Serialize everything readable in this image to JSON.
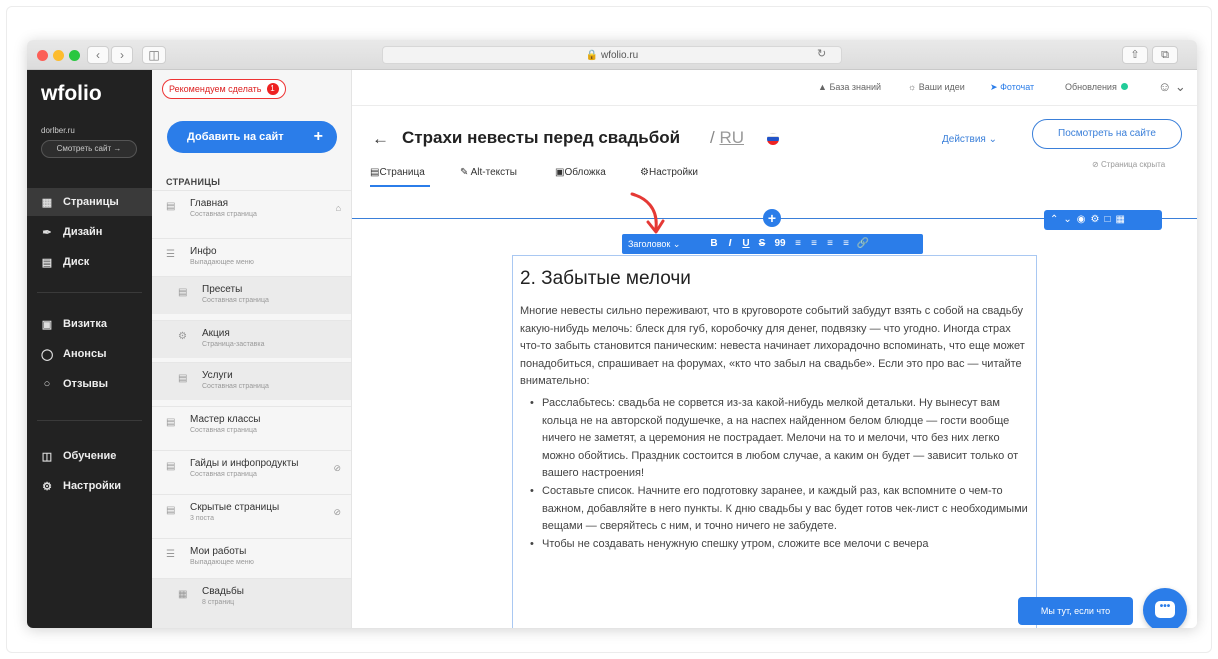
{
  "browser": {
    "url": "wfolio.ru"
  },
  "sidebar": {
    "logo": "wfolio",
    "site": "dorlber.ru",
    "view_site": "Смотреть сайт →",
    "items": [
      {
        "label": "Страницы",
        "icon": "page-icon"
      },
      {
        "label": "Дизайн",
        "icon": "brush-icon"
      },
      {
        "label": "Диск",
        "icon": "disk-icon"
      },
      {
        "label": "Визитка",
        "icon": "card-icon"
      },
      {
        "label": "Анонсы",
        "icon": "megaphone-icon"
      },
      {
        "label": "Отзывы",
        "icon": "chat-icon"
      },
      {
        "label": "Обучение",
        "icon": "book-icon"
      },
      {
        "label": "Настройки",
        "icon": "gear-icon"
      }
    ]
  },
  "pages_panel": {
    "recommend": "Рекомендуем сделать",
    "recommend_count": "1",
    "add_button": "Добавить на сайт",
    "heading": "СТРАНИЦЫ",
    "pages": [
      {
        "title": "Главная",
        "sub": "Составная страница"
      },
      {
        "title": "Инфо",
        "sub": "Выпадающее меню"
      },
      {
        "title": "Пресеты",
        "sub": "Составная страница"
      },
      {
        "title": "Акция",
        "sub": "Страница-заставка"
      },
      {
        "title": "Услуги",
        "sub": "Составная страница"
      },
      {
        "title": "Мастер классы",
        "sub": "Составная страница"
      },
      {
        "title": "Гайды и инфопродукты",
        "sub": "Составная страница"
      },
      {
        "title": "Скрытые страницы",
        "sub": "3 поста"
      },
      {
        "title": "Мои работы",
        "sub": "Выпадающее меню"
      },
      {
        "title": "Свадьбы",
        "sub": "8 страниц"
      }
    ]
  },
  "topbar": {
    "knowledge": "База знаний",
    "ideas": "Ваши идеи",
    "photochat": "Фоточат",
    "updates": "Обновления"
  },
  "header": {
    "title": "Страхи невесты перед свадьбой",
    "lang": "RU",
    "actions": "Действия",
    "view_button": "Посмотреть на сайте",
    "hidden_note": "Страница скрыта",
    "tabs": [
      "Страница",
      "Alt-тексты",
      "Обложка",
      "Настройки"
    ]
  },
  "toolbar": {
    "heading_select": "Заголовок",
    "buttons": [
      "B",
      "I",
      "U",
      "S",
      "99",
      "≡",
      "≡",
      "≡",
      "≡",
      "🔗"
    ]
  },
  "content": {
    "heading": "2. Забытые мелочи",
    "paragraph": "Многие невесты сильно переживают, что в круговороте событий забудут взять с собой на свадьбу какую-нибудь мелочь: блеск для губ, коробочку для денег, подвязку — что угодно. Иногда страх что-то забыть становится паническим: невеста начинает лихорадочно вспоминать, что еще может понадобиться, спрашивает на форумах, «кто что забыл на свадьбе». Если это про вас — читайте внимательно:",
    "bullets": [
      "Расслабьтесь: свадьба не сорвется из-за какой-нибудь мелкой детальки. Ну вынесут вам кольца не на авторской подушечке, а на наспех найденном белом блюдце — гости вообще ничего не заметят, а церемония не пострадает. Мелочи на то и мелочи, что без них легко можно обойтись. Праздник состоится в любом случае, а каким он будет — зависит только от вашего настроения!",
      "Составьте список. Начните его подготовку заранее, и каждый раз, как вспомните о чем-то важном, добавляйте в него пункты. К дню свадьбы у вас будет готов чек-лист с необходимыми вещами — сверяйтесь с ним, и точно ничего не забудете.",
      "Чтобы не создавать ненужную спешку утром, сложите все мелочи с вечера"
    ]
  },
  "chat": {
    "label": "Мы тут, если что"
  },
  "colors": {
    "accent": "#2b7de9",
    "sidebar": "#222222",
    "alert": "#e22222"
  }
}
